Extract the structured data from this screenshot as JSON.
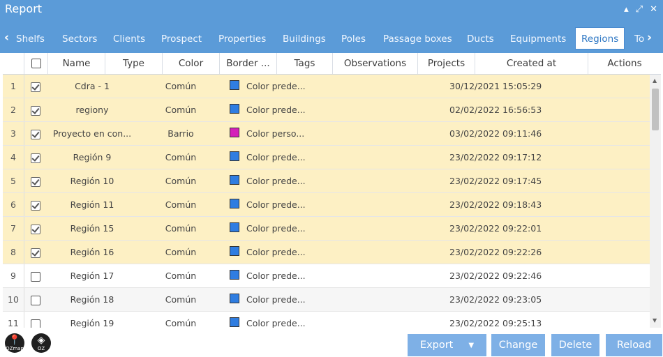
{
  "window": {
    "title": "Report",
    "controls": [
      "▴",
      "⤢",
      "✕"
    ]
  },
  "tabs": {
    "items": [
      "Shelfs",
      "Sectors",
      "Clients",
      "Prospect",
      "Properties",
      "Buildings",
      "Poles",
      "Passage boxes",
      "Ducts",
      "Equipments",
      "Regions",
      "To"
    ],
    "active": "Regions"
  },
  "table": {
    "columns": [
      "Name",
      "Type",
      "Color",
      "Border ...",
      "Tags",
      "Observations",
      "Projects",
      "Created at",
      "Actions"
    ],
    "rows": [
      {
        "n": "1",
        "checked": true,
        "name": "Cdra - 1",
        "type": "Común",
        "swatch": "#2f7de1",
        "border": "Color prede...",
        "created": "30/12/2021 15:05:29"
      },
      {
        "n": "2",
        "checked": true,
        "name": "regiony",
        "type": "Común",
        "swatch": "#2f7de1",
        "border": "Color prede...",
        "created": "02/02/2022 16:56:53"
      },
      {
        "n": "3",
        "checked": true,
        "name": "Proyecto en con...",
        "type": "Barrio",
        "swatch": "#d41fb9",
        "border": "Color perso...",
        "created": "03/02/2022 09:11:46"
      },
      {
        "n": "4",
        "checked": true,
        "name": "Región 9",
        "type": "Común",
        "swatch": "#2f7de1",
        "border": "Color prede...",
        "created": "23/02/2022 09:17:12"
      },
      {
        "n": "5",
        "checked": true,
        "name": "Región 10",
        "type": "Común",
        "swatch": "#2f7de1",
        "border": "Color prede...",
        "created": "23/02/2022 09:17:45"
      },
      {
        "n": "6",
        "checked": true,
        "name": "Región 11",
        "type": "Común",
        "swatch": "#2f7de1",
        "border": "Color prede...",
        "created": "23/02/2022 09:18:43"
      },
      {
        "n": "7",
        "checked": true,
        "name": "Región 15",
        "type": "Común",
        "swatch": "#2f7de1",
        "border": "Color prede...",
        "created": "23/02/2022 09:22:01"
      },
      {
        "n": "8",
        "checked": true,
        "name": "Región 16",
        "type": "Común",
        "swatch": "#2f7de1",
        "border": "Color prede...",
        "created": "23/02/2022 09:22:26"
      },
      {
        "n": "9",
        "checked": false,
        "name": "Región 17",
        "type": "Común",
        "swatch": "#2f7de1",
        "border": "Color prede...",
        "created": "23/02/2022 09:22:46"
      },
      {
        "n": "10",
        "checked": false,
        "name": "Región 18",
        "type": "Común",
        "swatch": "#2f7de1",
        "border": "Color prede...",
        "created": "23/02/2022 09:23:05"
      },
      {
        "n": "11",
        "checked": false,
        "name": "Región 19",
        "type": "Común",
        "swatch": "#2f7de1",
        "border": "Color prede...",
        "created": "23/02/2022 09:25:13"
      }
    ]
  },
  "footer": {
    "logos": [
      {
        "top": "📍",
        "bottom": "OZmap"
      },
      {
        "top": "◈",
        "bottom": "OZ"
      }
    ],
    "buttons": [
      "Export",
      "Change",
      "Delete",
      "Reload"
    ]
  },
  "colors": {
    "primary": "#5b9bd8",
    "button": "#7eb0e6",
    "selected_row": "#fdf0c4"
  }
}
